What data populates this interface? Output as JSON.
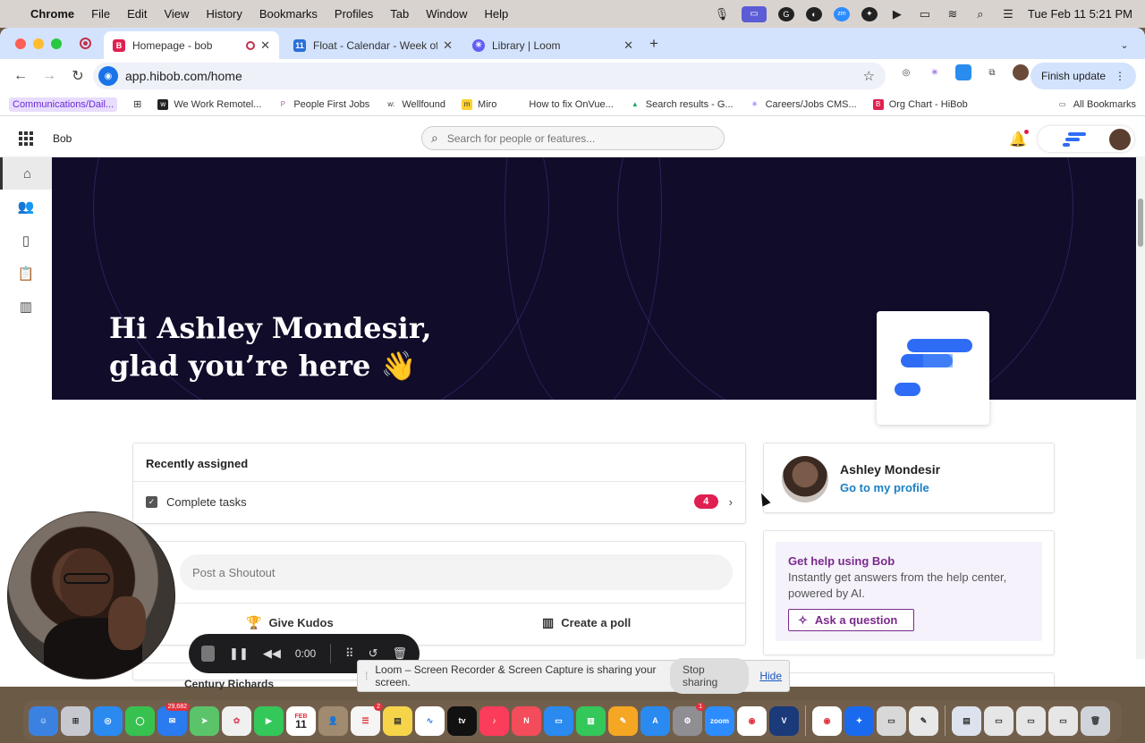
{
  "menubar": {
    "app": "Chrome",
    "items": [
      "File",
      "Edit",
      "View",
      "History",
      "Bookmarks",
      "Profiles",
      "Tab",
      "Window",
      "Help"
    ],
    "datetime": "Tue Feb 11  5:21 PM"
  },
  "tabs": [
    {
      "title": "Homepage - bob",
      "favicon": "bob-icon",
      "active": true
    },
    {
      "title": "Float - Calendar - Week of Fe",
      "favicon": "float-calendar-icon",
      "active": false
    },
    {
      "title": "Library | Loom",
      "favicon": "loom-icon",
      "active": false
    }
  ],
  "toolbar": {
    "url": "app.hibob.com/home",
    "finish_update": "Finish update"
  },
  "bookmarks": [
    "Communications/Dail...",
    "We Work Remotel...",
    "People First Jobs",
    "Wellfound",
    "Miro",
    "How to fix OnVue...",
    "Search results - G...",
    "Careers/Jobs CMS...",
    "Org Chart - HiBob"
  ],
  "all_bookmarks": "All Bookmarks",
  "bob": {
    "app_name": "Bob",
    "search_placeholder": "Search for people or features...",
    "hero": {
      "greeting_line1": "Hi Ashley Mondesir,",
      "greeting_line2": "glad you’re here 👋"
    },
    "recently_assigned": {
      "title": "Recently assigned",
      "item_label": "Complete tasks",
      "count": "4"
    },
    "shoutout": {
      "placeholder": "Post a Shoutout",
      "give_kudos": "Give Kudos",
      "create_poll": "Create a poll"
    },
    "next_post_author": "Century Richards",
    "profile": {
      "name": "Ashley Mondesir",
      "link": "Go to my profile"
    },
    "help": {
      "title": "Get help using Bob",
      "text": "Instantly get answers from the help center, powered by AI.",
      "button": "Ask a question"
    }
  },
  "loom": {
    "timer": "0:00",
    "share_message": "Loom – Screen Recorder & Screen Capture is sharing your screen.",
    "stop_sharing": "Stop sharing",
    "hide": "Hide"
  },
  "dock": {
    "mail_badge": "29,682",
    "calendar_month": "FEB",
    "calendar_day": "11",
    "reminders_badge": "2",
    "settings_badge": "1",
    "zoom_label": "zoom"
  },
  "colors": {
    "hero_bg": "#100c2a",
    "bob_logo_blue": "#2f6cf6",
    "badge_red": "#e02050",
    "link_blue": "#1a7fc4",
    "help_purple": "#7a2b8c"
  }
}
